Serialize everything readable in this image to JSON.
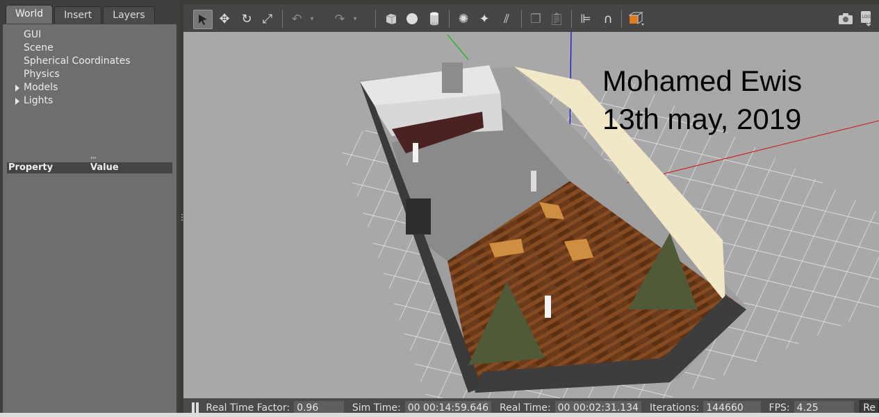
{
  "tabs": [
    "World",
    "Insert",
    "Layers"
  ],
  "tree": [
    {
      "label": "GUI",
      "expandable": false
    },
    {
      "label": "Scene",
      "expandable": false
    },
    {
      "label": "Spherical Coordinates",
      "expandable": false
    },
    {
      "label": "Physics",
      "expandable": false
    },
    {
      "label": "Models",
      "expandable": true
    },
    {
      "label": "Lights",
      "expandable": true
    }
  ],
  "splitter_dots": "'''",
  "property_header": {
    "property": "Property",
    "value": "Value"
  },
  "overlay": {
    "line1": "Mohamed Ewis",
    "line2": "13th may, 2019"
  },
  "status": {
    "rtf_label": "Real Time Factor:",
    "rtf_value": "0.96",
    "sim_label": "Sim Time:",
    "sim_value": "00 00:14:59.646",
    "real_label": "Real Time:",
    "real_value": "00 00:02:31.134",
    "iter_label": "Iterations:",
    "iter_value": "144660",
    "fps_label": "FPS:",
    "fps_value": "4.25",
    "reset_label": "Re"
  },
  "colors": {
    "accent": "#e07a1f",
    "axis_x": "#d01010",
    "axis_y": "#19b519",
    "axis_z": "#1010d0"
  }
}
